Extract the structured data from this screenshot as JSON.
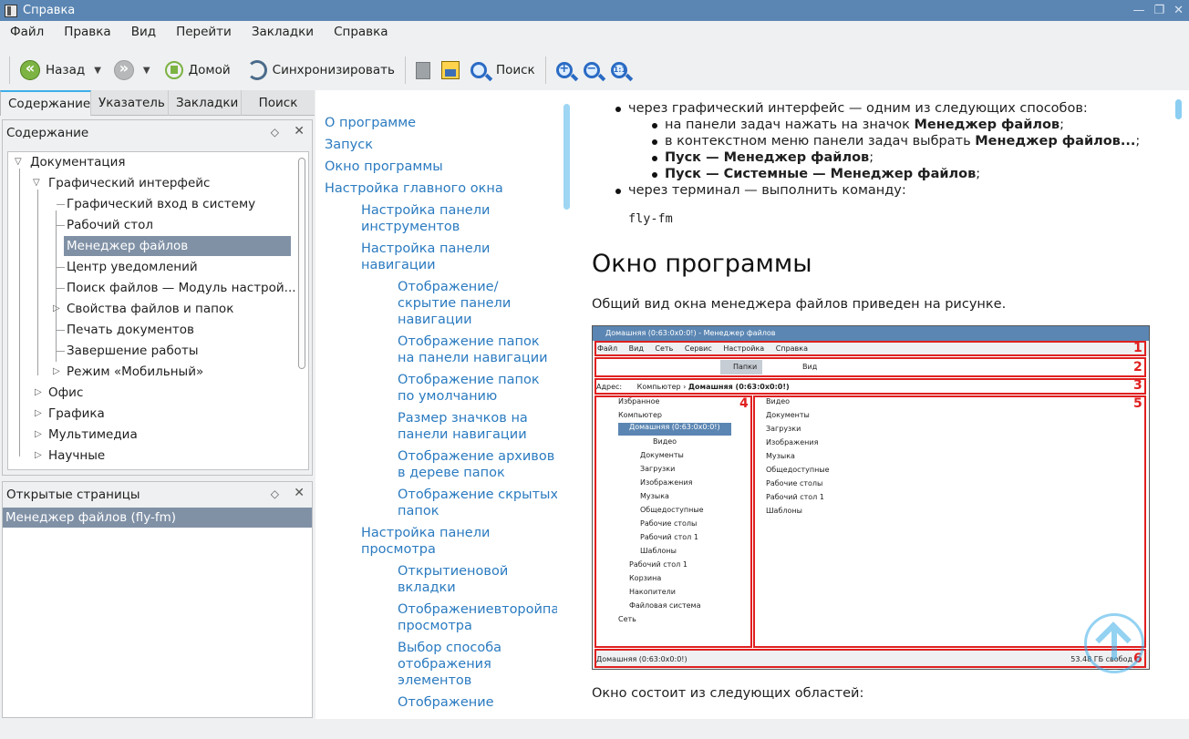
{
  "window": {
    "title": "Справка"
  },
  "menu": [
    "Файл",
    "Правка",
    "Вид",
    "Перейти",
    "Закладки",
    "Справка"
  ],
  "toolbar": {
    "back": "Назад",
    "home": "Домой",
    "sync": "Синхронизировать",
    "search": "Поиск"
  },
  "sidebar": {
    "tabs": [
      "Содержание",
      "Указатель",
      "Закладки",
      "Поиск"
    ],
    "panel_title": "Содержание",
    "tree": [
      "Документация",
      "Графический интерфейс",
      "Графический вход в систему",
      "Рабочий стол",
      "Менеджер файлов",
      "Центр уведомлений",
      "Поиск файлов — Модуль настрой...",
      "Свойства файлов и папок",
      "Печать документов",
      "Завершение работы",
      "Режим «Мобильный»",
      "Офис",
      "Графика",
      "Мультимедиа",
      "Научные"
    ],
    "open_pages_title": "Открытые страницы",
    "open_pages": [
      "Менеджер файлов (fly-fm)"
    ]
  },
  "toc": [
    "О программе",
    "Запуск",
    "Окно программы",
    "Настройка главного окна",
    "Настройка панели",
    "инструментов",
    "Настройка панели",
    "навигации",
    "Отображение/",
    "скрытие панели",
    "навигации",
    "Отображение папок",
    "на панели навигации",
    "Отображение папок",
    "по умолчанию",
    "Размер значков на",
    "панели навигации",
    "Отображение архивов",
    "в дереве папок",
    "Отображение скрытых",
    "папок",
    "Настройка панели",
    "просмотра",
    "Открытиеновой",
    "вкладки",
    "Отображениевторойпан",
    "просмотра",
    "Выбор способа",
    "отображения",
    "элементов",
    "Отображение"
  ],
  "content": {
    "bullet1": "через графический интерфейс — одним из следующих способов:",
    "sub1a": "на панели задач нажать на значок ",
    "sub1b": "Менеджер файлов",
    "sub1c": ";",
    "sub2a": "в контекстном меню панели задач выбрать ",
    "sub2b": "Менеджер файлов...",
    "sub2c": ";",
    "sub3b": "Пуск — Менеджер файлов",
    "sub3c": ";",
    "sub4b": "Пуск — Системные — Менеджер файлов",
    "sub4c": ";",
    "bullet2": "через терминал — выполнить команду:",
    "command": "fly-fm",
    "heading": "Окно программы",
    "para": "Общий вид окна менеджера файлов приведен на рисунке.",
    "after": "Окно состоит из следующих областей:"
  },
  "figure": {
    "title": "Домашняя (0:63:0x0:0!) - Менеджер файлов",
    "menu": [
      "Файл",
      "Вид",
      "Сеть",
      "Сервис",
      "Настройка",
      "Справка"
    ],
    "folders_btn": "Папки",
    "view_btn": "Вид",
    "address_label": "Адрес:",
    "address_a": "Компьютер",
    "address_b": "Домашняя (0:63:0x0:0!)",
    "tree": [
      "Избранное",
      "Компьютер",
      "Домашняя (0:63:0x0:0!)",
      "Видео",
      "Документы",
      "Загрузки",
      "Изображения",
      "Музыка",
      "Общедоступные",
      "Рабочие столы",
      "Рабочий стол 1",
      "Шаблоны",
      "Рабочий стол 1",
      "Корзина",
      "Накопители",
      "Файловая система",
      "Сеть"
    ],
    "right": [
      "Видео",
      "Документы",
      "Загрузки",
      "Изображения",
      "Музыка",
      "Общедоступные",
      "Рабочие столы",
      "Рабочий стол 1",
      "Шаблоны"
    ],
    "status": "Домашняя (0:63:0x0:0!)",
    "status_right": "53.48 ГБ свобод",
    "numbers": [
      "1",
      "2",
      "3",
      "4",
      "5",
      "6"
    ]
  }
}
